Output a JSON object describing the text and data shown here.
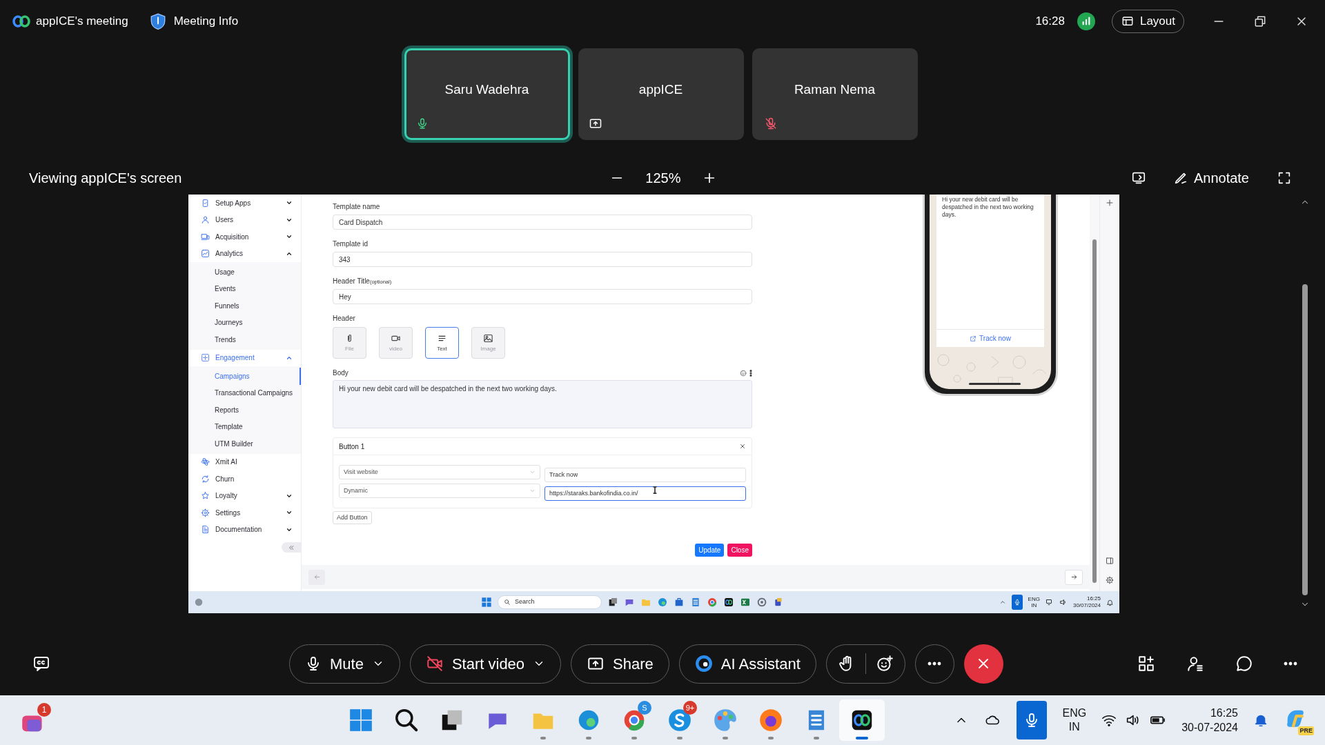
{
  "meeting": {
    "title": "appICE's meeting",
    "info": "Meeting Info",
    "time": "16:28",
    "layout": "Layout"
  },
  "participants": [
    {
      "name": "Saru Wadehra",
      "kind": "mic",
      "selected": true
    },
    {
      "name": "appICE",
      "kind": "sharing",
      "selected": false
    },
    {
      "name": "Raman Nema",
      "kind": "muted",
      "selected": false
    }
  ],
  "viewing": {
    "label": "Viewing appICE's screen",
    "zoom": "125%",
    "annotate": "Annotate"
  },
  "shared_screen": {
    "sidebar": {
      "items": [
        {
          "label": "Setup Apps",
          "kind": "group",
          "expanded": false,
          "selected": false
        },
        {
          "label": "Users",
          "kind": "group",
          "expanded": false,
          "selected": false
        },
        {
          "label": "Acquisition",
          "kind": "group",
          "expanded": false,
          "selected": false
        },
        {
          "label": "Analytics",
          "kind": "group",
          "expanded": true,
          "selected": false,
          "children": [
            {
              "label": "Usage",
              "selected": false
            },
            {
              "label": "Events",
              "selected": false
            },
            {
              "label": "Funnels",
              "selected": false
            },
            {
              "label": "Journeys",
              "selected": false
            },
            {
              "label": "Trends",
              "selected": false
            }
          ]
        },
        {
          "label": "Engagement",
          "kind": "group",
          "expanded": true,
          "selected": true,
          "children": [
            {
              "label": "Campaigns",
              "selected": true
            },
            {
              "label": "Transactional Campaigns",
              "selected": false
            },
            {
              "label": "Reports",
              "selected": false
            },
            {
              "label": "Template",
              "selected": false
            },
            {
              "label": "UTM Builder",
              "selected": false
            }
          ]
        },
        {
          "label": "Xmit AI",
          "kind": "link",
          "selected": false
        },
        {
          "label": "Churn",
          "kind": "link",
          "selected": false
        },
        {
          "label": "Loyalty",
          "kind": "group",
          "expanded": false,
          "selected": false
        },
        {
          "label": "Settings",
          "kind": "group",
          "expanded": false,
          "selected": false
        },
        {
          "label": "Documentation",
          "kind": "group",
          "expanded": false,
          "selected": false
        }
      ]
    },
    "form": {
      "fields": [
        {
          "label": "Template name",
          "value": "Card Dispatch"
        },
        {
          "label": "Template id",
          "value": "343"
        },
        {
          "label": "Header Title",
          "note": "(optional)",
          "value": "Hey"
        }
      ],
      "header": {
        "label": "Header",
        "types": [
          {
            "label": "File",
            "selected": false
          },
          {
            "label": "video",
            "selected": false
          },
          {
            "label": "Text",
            "selected": true
          },
          {
            "label": "Image",
            "selected": false
          }
        ]
      },
      "body": {
        "label": "Body",
        "value": "Hi your new debit card will be despatched in the next two working days."
      },
      "button_card": {
        "title": "Button 1",
        "fields": [
          {
            "kind": "select",
            "value": "Visit website"
          },
          {
            "kind": "input",
            "value": "Track now",
            "focused": false
          },
          {
            "kind": "select",
            "value": "Dynamic"
          },
          {
            "kind": "input",
            "value": "https://staraks.bankofindia.co.in/",
            "focused": true
          }
        ]
      },
      "add_button": "Add Button",
      "update": "Update",
      "close": "Close"
    },
    "preview": {
      "message": "Hi your new debit card will be despatched in the next two working days.",
      "action": "Track now"
    },
    "taskbar": {
      "search": "Search",
      "language": [
        "ENG",
        "IN"
      ],
      "time": "16:25",
      "date": "30/07/2024"
    }
  },
  "controls": [
    {
      "label": "Mute",
      "kind": "mic",
      "dropdown": true
    },
    {
      "label": "Start video",
      "kind": "video",
      "dropdown": true
    },
    {
      "label": "Share",
      "kind": "share",
      "dropdown": false
    },
    {
      "label": "AI Assistant",
      "kind": "assistant",
      "dropdown": false
    }
  ],
  "taskbar": {
    "left_badge": "1",
    "apps": [
      {
        "running": false,
        "active": false
      },
      {
        "running": false,
        "active": false
      },
      {
        "running": false,
        "active": false
      },
      {
        "running": false,
        "active": false
      },
      {
        "running": true,
        "active": false
      },
      {
        "running": true,
        "active": false
      },
      {
        "running": true,
        "active": false,
        "badge": "S"
      },
      {
        "running": true,
        "active": false,
        "badge": "9+"
      },
      {
        "running": true,
        "active": false
      },
      {
        "running": true,
        "active": false
      },
      {
        "running": true,
        "active": false
      },
      {
        "running": true,
        "active": true
      }
    ],
    "language": [
      "ENG",
      "IN"
    ],
    "time": "16:25",
    "date": "30-07-2024",
    "copilot_tag": "PRE"
  }
}
